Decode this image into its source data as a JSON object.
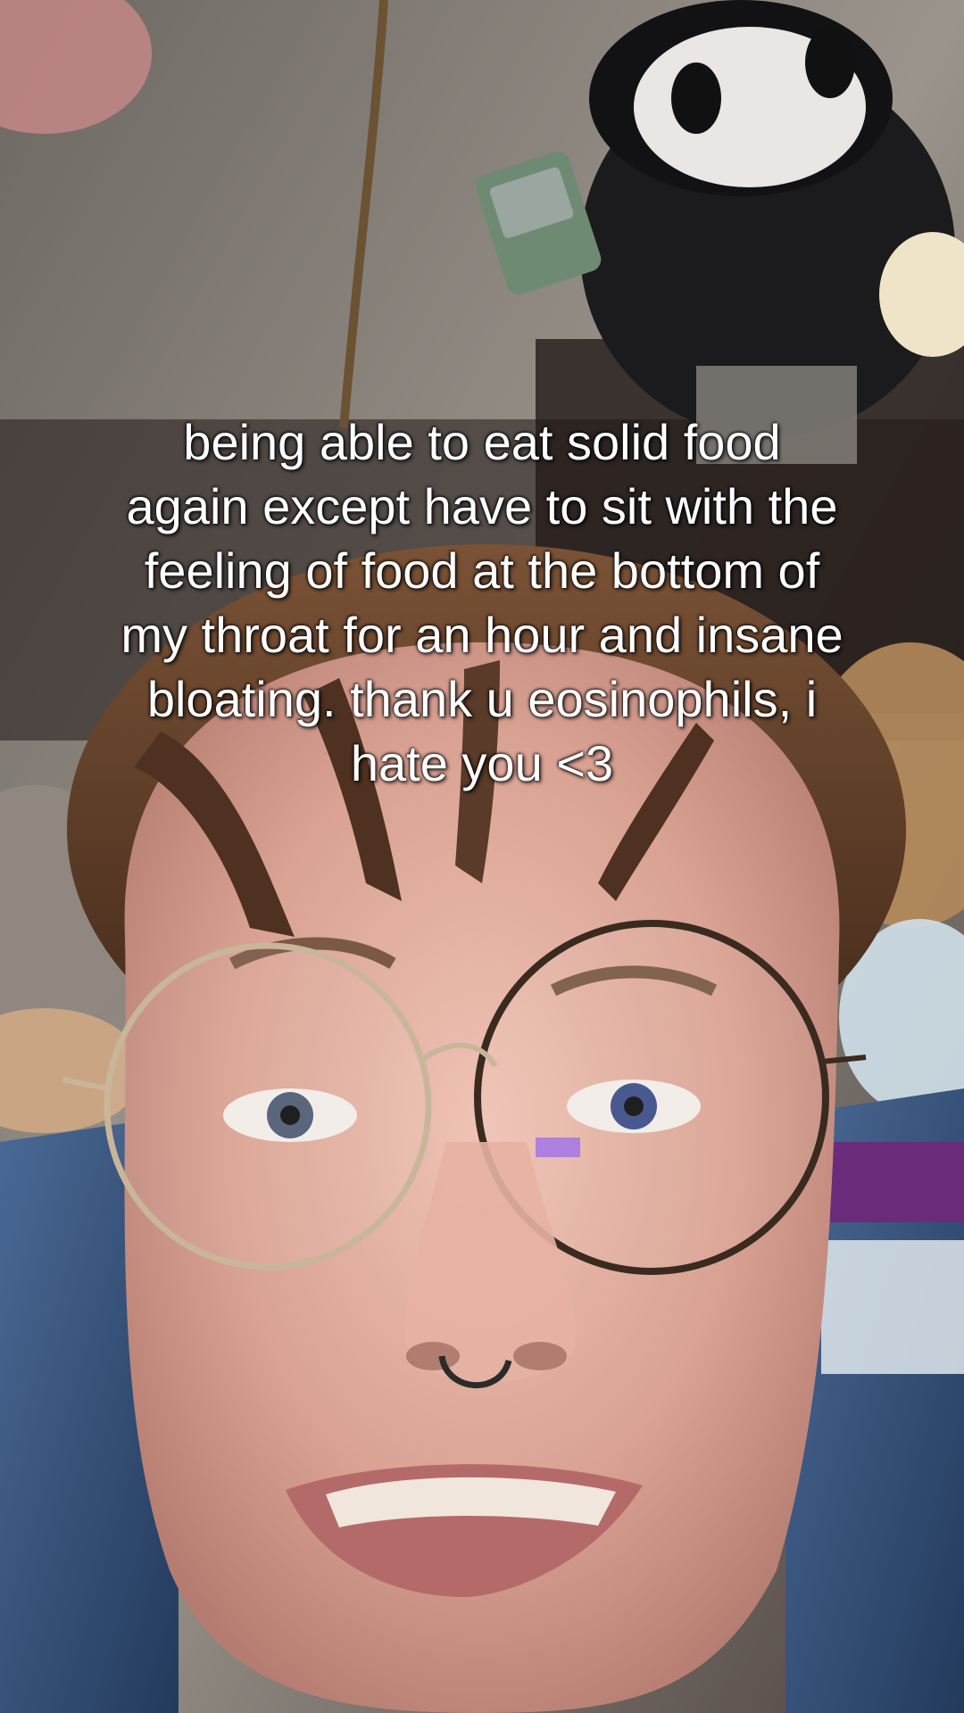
{
  "video": {
    "caption_lines": [
      "being able to eat solid food",
      "again except have to sit with the",
      "feeling of food at the bottom of",
      "my throat for an hour and insane",
      "bloating. thank u eosinophils, i",
      "hate you <3"
    ]
  },
  "colors": {
    "wall": "#8a857e",
    "wall_shadow": "#3a302b",
    "hair": "#5a3a28",
    "skin": "#d9a89a",
    "plush_black": "#1b1a1c",
    "plush_white": "#e9e6e3",
    "blanket_blue": "#3c5a86",
    "blanket_purple": "#6a2b7a"
  }
}
